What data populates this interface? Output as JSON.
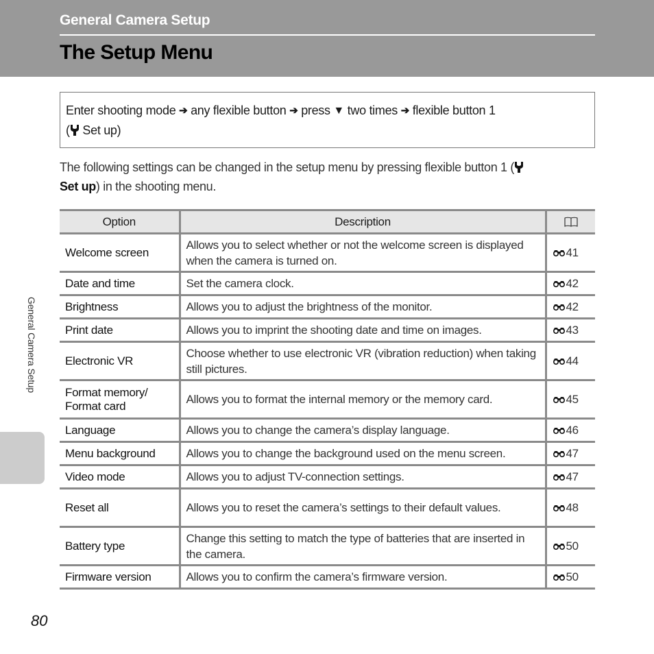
{
  "header": {
    "section_title": "General Camera Setup",
    "page_title": "The Setup Menu"
  },
  "navigation": {
    "step1": "Enter shooting mode",
    "step2": "any flexible button",
    "step3_prefix": "press",
    "step3_suffix": "two times",
    "step4": "flexible button 1",
    "step4_paren_open": "(",
    "step4_label": "Set up)",
    "arrow_icon": "right-arrow-icon",
    "down_icon": "down-triangle-icon",
    "set_up_icon": "wrench-icon"
  },
  "intro": {
    "text_before": "The following settings can be changed in the setup menu by pressing flexible button 1 (",
    "bold_label": "Set up",
    "text_after": ") in the shooting menu."
  },
  "table": {
    "headers": {
      "option": "Option",
      "description": "Description",
      "reference_icon": "book-icon"
    },
    "reference_prefix_icon": "binoculars-icon",
    "rows": [
      {
        "option": "Welcome screen",
        "description": "Allows you to select whether or not the welcome screen is displayed when the camera is turned on.",
        "page": "41"
      },
      {
        "option": "Date and time",
        "description": "Set the camera clock.",
        "page": "42"
      },
      {
        "option": "Brightness",
        "description": "Allows you to adjust the brightness of the monitor.",
        "page": "42"
      },
      {
        "option": "Print date",
        "description": "Allows you to imprint the shooting date and time on images.",
        "page": "43"
      },
      {
        "option": "Electronic VR",
        "description": "Choose whether to use electronic VR (vibration reduction) when taking still pictures.",
        "page": "44"
      },
      {
        "option": "Format memory/ Format card",
        "description": "Allows you to format the internal memory or the memory card.",
        "page": "45"
      },
      {
        "option": "Language",
        "description": "Allows you to change the camera’s display language.",
        "page": "46"
      },
      {
        "option": "Menu background",
        "description": "Allows you to change the background used on the menu screen.",
        "page": "47"
      },
      {
        "option": "Video mode",
        "description": "Allows you to adjust TV-connection settings.",
        "page": "47"
      },
      {
        "option": "Reset all",
        "description": "Allows you to reset the camera’s settings to their default values.",
        "page": "48"
      },
      {
        "option": "Battery type",
        "description": "Change this setting to match the type of batteries that are inserted in the camera.",
        "page": "50"
      },
      {
        "option": "Firmware version",
        "description": "Allows you to confirm the camera’s firmware version.",
        "page": "50"
      }
    ]
  },
  "sidebar": {
    "label": "General Camera Setup"
  },
  "footer": {
    "page_number": "80"
  },
  "colors": {
    "header_bg": "#999999",
    "table_header_bg": "#e6e6e6",
    "table_border": "#8a8a8a",
    "side_tab": "#cccccc"
  }
}
